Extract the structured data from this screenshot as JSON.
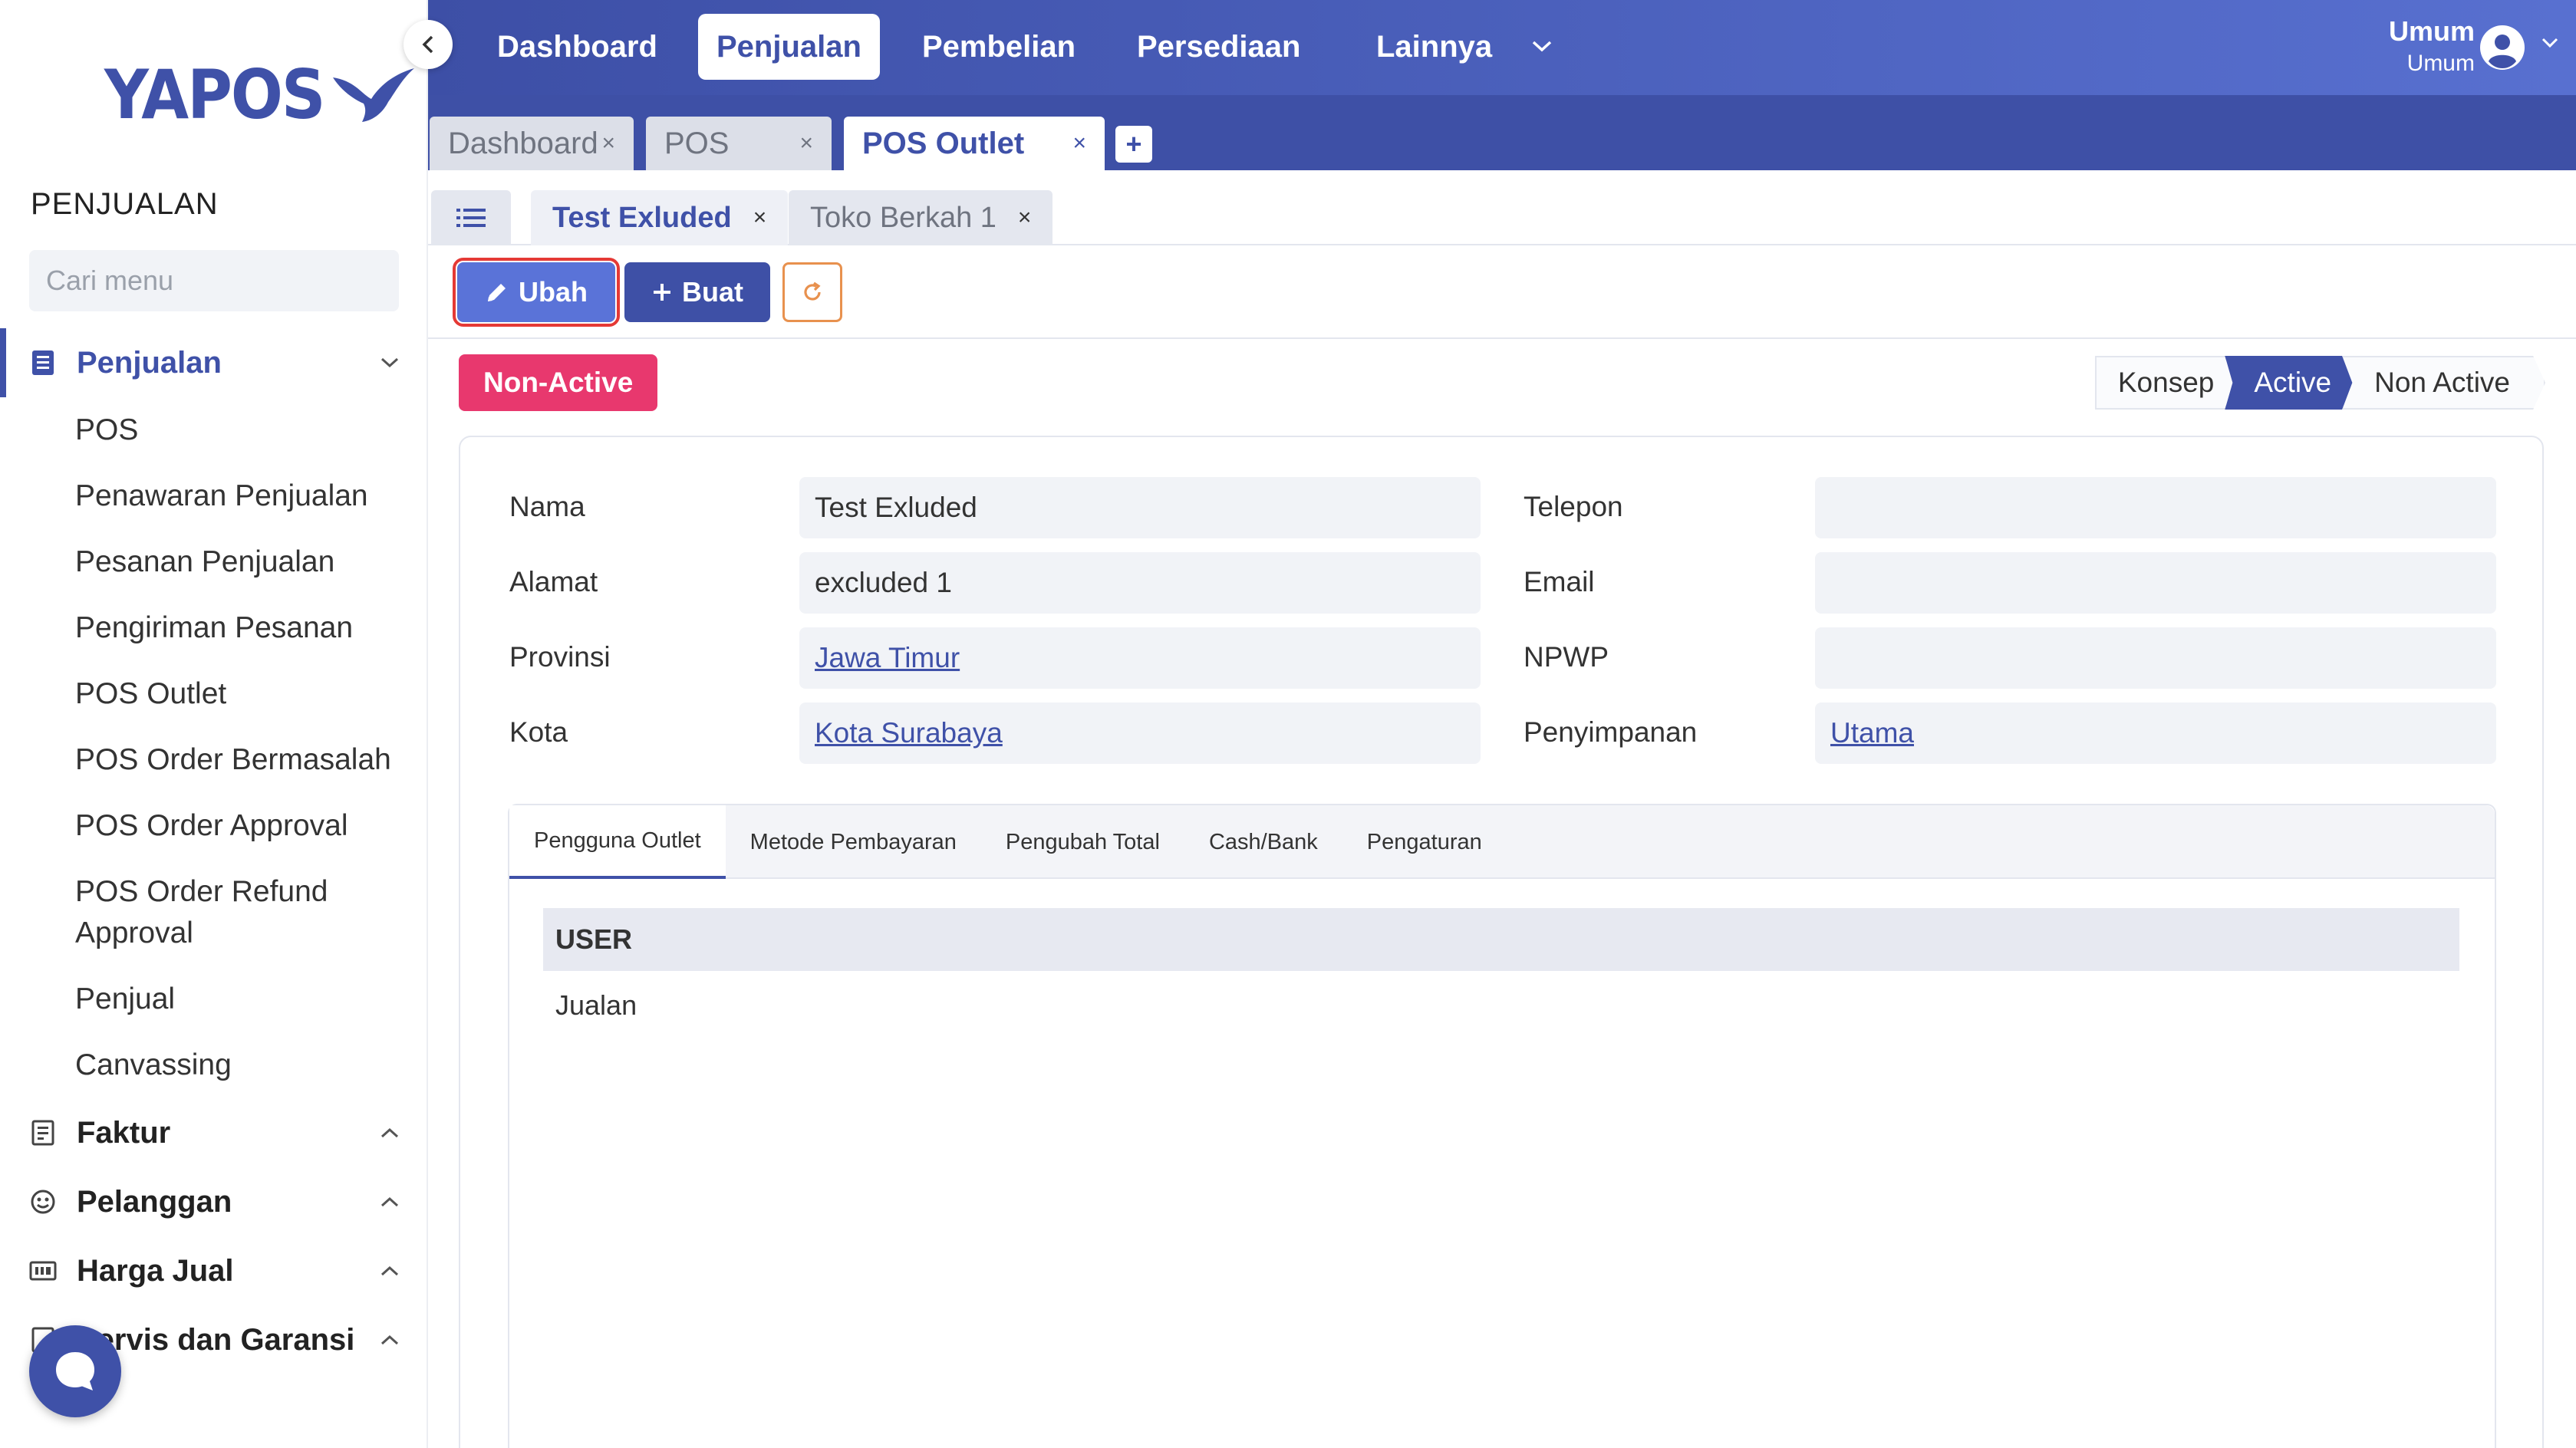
{
  "sidebar": {
    "logo": "YAPOS",
    "section_title": "PENJUALAN",
    "search_placeholder": "Cari menu",
    "groups": [
      {
        "label": "Penjualan",
        "icon": "document-list-icon"
      },
      {
        "label": "Faktur",
        "icon": "receipt-icon"
      },
      {
        "label": "Pelanggan",
        "icon": "smile-icon"
      },
      {
        "label": "Harga Jual",
        "icon": "price-tag-icon"
      },
      {
        "label": "Servis dan Garansi",
        "icon": "service-icon"
      }
    ],
    "sub_items": [
      "POS",
      "Penawaran Penjualan",
      "Pesanan Penjualan",
      "Pengiriman Pesanan",
      "POS Outlet",
      "POS Order Bermasalah",
      "POS Order Approval",
      "POS Order Refund Approval",
      "Penjual",
      "Canvassing"
    ]
  },
  "topnav": {
    "items": [
      "Dashboard",
      "Penjualan",
      "Pembelian",
      "Persediaan",
      "Lainnya"
    ],
    "active": "Penjualan",
    "user_name": "Umum",
    "user_role": "Umum"
  },
  "tabs": {
    "main": [
      "Dashboard",
      "POS",
      "POS Outlet"
    ],
    "active_main": "POS Outlet",
    "close_symbol": "×",
    "add_symbol": "+",
    "sub": [
      "Test Exluded",
      "Toko Berkah 1"
    ],
    "active_sub": "Test Exluded"
  },
  "toolbar": {
    "edit_label": "Ubah",
    "create_label": "Buat"
  },
  "status": {
    "badge": "Non-Active",
    "steps": [
      "Konsep",
      "Active",
      "Non Active"
    ],
    "current_step": "Active"
  },
  "form": {
    "left": [
      {
        "label": "Nama",
        "value": "Test Exluded",
        "link": false
      },
      {
        "label": "Alamat",
        "value": "excluded 1",
        "link": false
      },
      {
        "label": "Provinsi",
        "value": "Jawa Timur",
        "link": true
      },
      {
        "label": "Kota",
        "value": "Kota Surabaya",
        "link": true
      }
    ],
    "right": [
      {
        "label": "Telepon",
        "value": "",
        "link": false
      },
      {
        "label": "Email",
        "value": "",
        "link": false
      },
      {
        "label": "NPWP",
        "value": "",
        "link": false
      },
      {
        "label": "Penyimpanan",
        "value": "Utama",
        "link": true
      }
    ]
  },
  "detail_tabs": {
    "items": [
      "Pengguna Outlet",
      "Metode Pembayaran",
      "Pengubah Total",
      "Cash/Bank",
      "Pengaturan"
    ],
    "active": "Pengguna Outlet",
    "table_header": "USER",
    "rows": [
      "Jualan"
    ]
  },
  "colors": {
    "primary": "#3f51a8",
    "accent_pink": "#e8386e",
    "refresh_orange": "#e8914e",
    "highlight_red": "#e53935"
  }
}
